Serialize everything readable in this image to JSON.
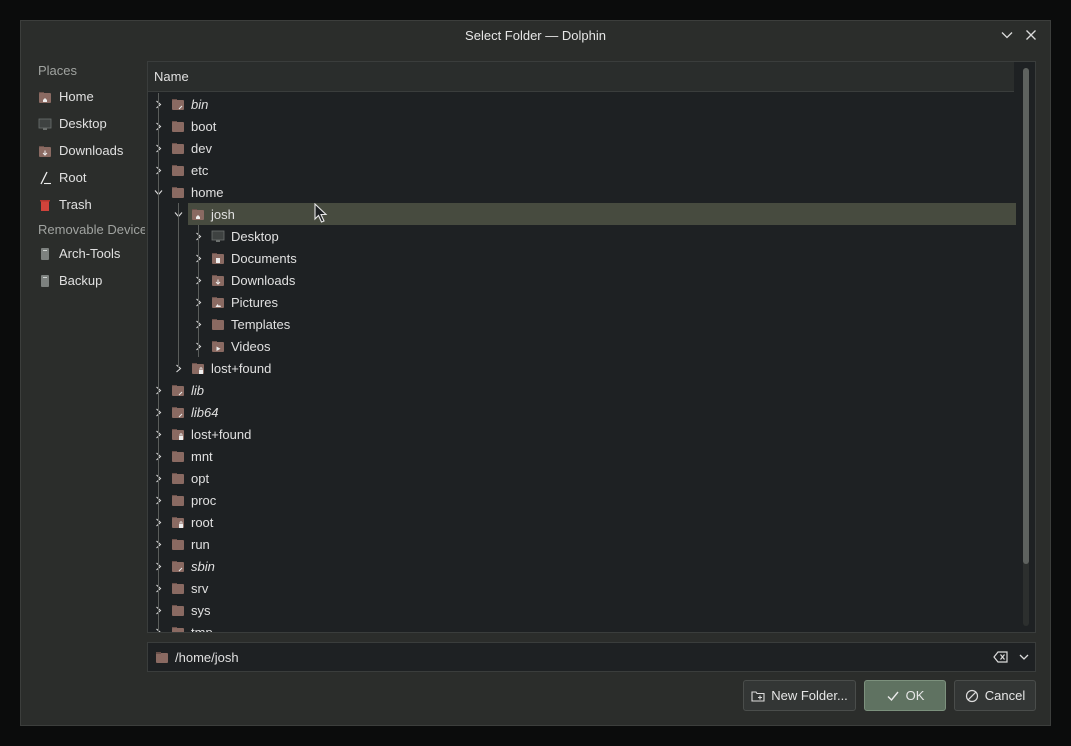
{
  "window": {
    "title": "Select Folder — Dolphin"
  },
  "places": {
    "header": "Places",
    "items": [
      {
        "label": "Home",
        "icon": "home-folder-icon"
      },
      {
        "label": "Desktop",
        "icon": "desktop-icon"
      },
      {
        "label": "Downloads",
        "icon": "downloads-folder-icon"
      },
      {
        "label": "Root",
        "icon": "root-icon"
      },
      {
        "label": "Trash",
        "icon": "trash-icon"
      }
    ],
    "removable_header": "Removable Devices",
    "removable": [
      {
        "label": "Arch-Tools",
        "icon": "drive-icon"
      },
      {
        "label": "Backup",
        "icon": "drive-icon"
      }
    ]
  },
  "tree": {
    "column_header": "Name",
    "rows": [
      {
        "label": "bin",
        "level": 0,
        "expanded": false,
        "italic": true,
        "icon": "symlink-folder-icon"
      },
      {
        "label": "boot",
        "level": 0,
        "expanded": false,
        "italic": false,
        "icon": "folder-icon"
      },
      {
        "label": "dev",
        "level": 0,
        "expanded": false,
        "italic": false,
        "icon": "folder-icon"
      },
      {
        "label": "etc",
        "level": 0,
        "expanded": false,
        "italic": false,
        "icon": "folder-icon"
      },
      {
        "label": "home",
        "level": 0,
        "expanded": true,
        "italic": false,
        "icon": "folder-icon"
      },
      {
        "label": "josh",
        "level": 1,
        "expanded": true,
        "italic": false,
        "icon": "home-folder-icon",
        "selected": true
      },
      {
        "label": "Desktop",
        "level": 2,
        "expanded": false,
        "italic": false,
        "icon": "desktop-folder-icon"
      },
      {
        "label": "Documents",
        "level": 2,
        "expanded": false,
        "italic": false,
        "icon": "documents-folder-icon"
      },
      {
        "label": "Downloads",
        "level": 2,
        "expanded": false,
        "italic": false,
        "icon": "downloads-folder-icon"
      },
      {
        "label": "Pictures",
        "level": 2,
        "expanded": false,
        "italic": false,
        "icon": "pictures-folder-icon"
      },
      {
        "label": "Templates",
        "level": 2,
        "expanded": false,
        "italic": false,
        "icon": "templates-folder-icon"
      },
      {
        "label": "Videos",
        "level": 2,
        "expanded": false,
        "italic": false,
        "icon": "videos-folder-icon"
      },
      {
        "label": "lost+found",
        "level": 1,
        "expanded": false,
        "italic": false,
        "icon": "locked-folder-icon"
      },
      {
        "label": "lib",
        "level": 0,
        "expanded": false,
        "italic": true,
        "icon": "symlink-folder-icon"
      },
      {
        "label": "lib64",
        "level": 0,
        "expanded": false,
        "italic": true,
        "icon": "symlink-folder-icon"
      },
      {
        "label": "lost+found",
        "level": 0,
        "expanded": false,
        "italic": false,
        "icon": "locked-folder-icon"
      },
      {
        "label": "mnt",
        "level": 0,
        "expanded": false,
        "italic": false,
        "icon": "folder-icon"
      },
      {
        "label": "opt",
        "level": 0,
        "expanded": false,
        "italic": false,
        "icon": "folder-icon"
      },
      {
        "label": "proc",
        "level": 0,
        "expanded": false,
        "italic": false,
        "icon": "folder-icon"
      },
      {
        "label": "root",
        "level": 0,
        "expanded": false,
        "italic": false,
        "icon": "locked-folder-icon"
      },
      {
        "label": "run",
        "level": 0,
        "expanded": false,
        "italic": false,
        "icon": "folder-icon"
      },
      {
        "label": "sbin",
        "level": 0,
        "expanded": false,
        "italic": true,
        "icon": "symlink-folder-icon"
      },
      {
        "label": "srv",
        "level": 0,
        "expanded": false,
        "italic": false,
        "icon": "folder-icon"
      },
      {
        "label": "sys",
        "level": 0,
        "expanded": false,
        "italic": false,
        "icon": "folder-icon"
      },
      {
        "label": "tmp",
        "level": 0,
        "expanded": false,
        "italic": false,
        "icon": "folder-icon"
      }
    ]
  },
  "path": {
    "value": "/home/josh"
  },
  "buttons": {
    "new_folder": "New Folder...",
    "ok": "OK",
    "cancel": "Cancel"
  },
  "colors": {
    "folder": "#8a6a62",
    "folder_dark": "#6a504a",
    "selection": "#474b3f",
    "ok_button": "#5f7261",
    "trash": "#d0433b"
  }
}
